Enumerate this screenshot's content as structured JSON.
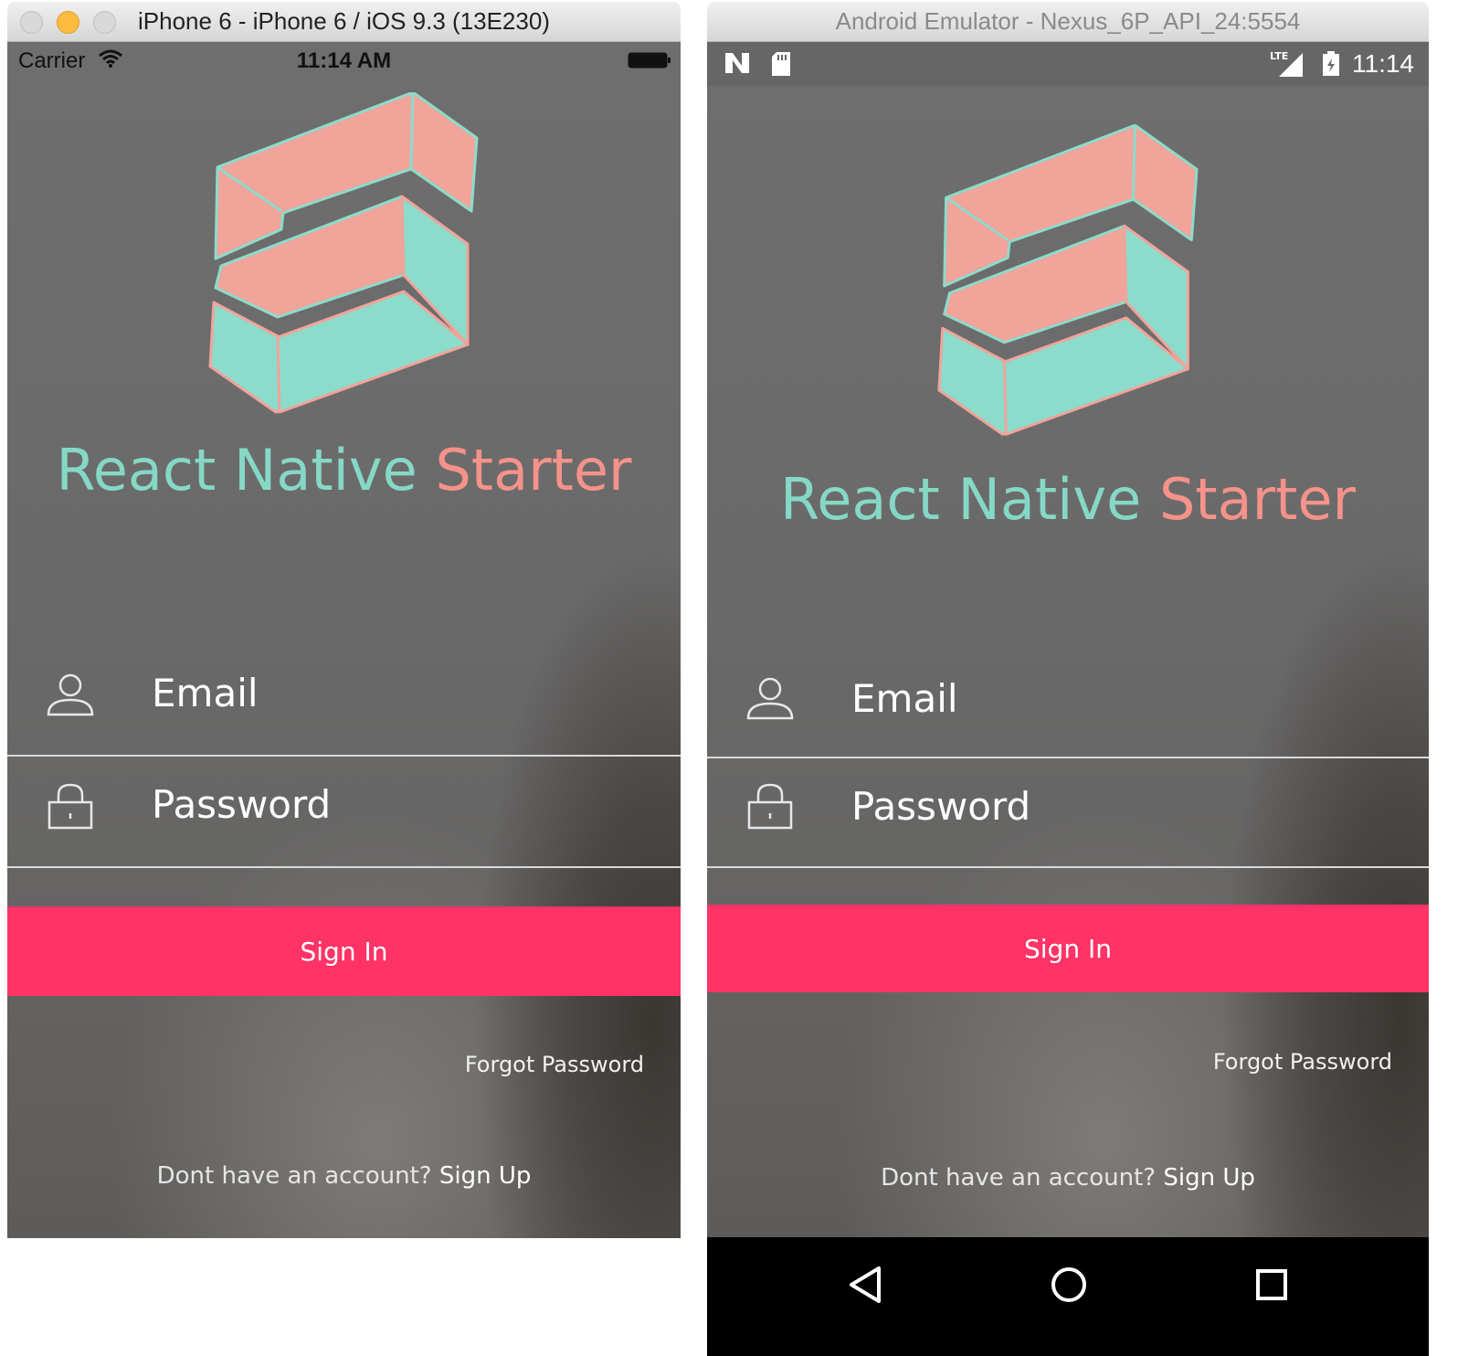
{
  "ios": {
    "window_title": "iPhone 6 - iPhone 6 / iOS 9.3 (13E230)",
    "status": {
      "carrier": "Carrier",
      "time": "11:14 AM"
    },
    "app": {
      "title_part1": "React Native",
      "title_part2": "Starter",
      "email_label": "Email",
      "password_label": "Password",
      "signin_label": "Sign In",
      "forgot_label": "Forgot Password",
      "signup_prompt": "Dont have an account?",
      "signup_link": "Sign Up"
    }
  },
  "android": {
    "window_title": "Android Emulator - Nexus_6P_API_24:5554",
    "status": {
      "time": "11:14",
      "network": "LTE"
    },
    "app": {
      "title_part1": "React Native",
      "title_part2": "Starter",
      "email_label": "Email",
      "password_label": "Password",
      "signin_label": "Sign In",
      "forgot_label": "Forgot Password",
      "signup_prompt": "Dont have an account?",
      "signup_link": "Sign Up"
    },
    "nav_icons": [
      "back-icon",
      "home-icon",
      "recents-icon"
    ]
  },
  "colors": {
    "accent_teal": "#86d8c6",
    "accent_pink": "#f5928a",
    "button": "#ff3366",
    "logo_pink": "#f2a39a",
    "logo_teal": "#8bdccb"
  }
}
